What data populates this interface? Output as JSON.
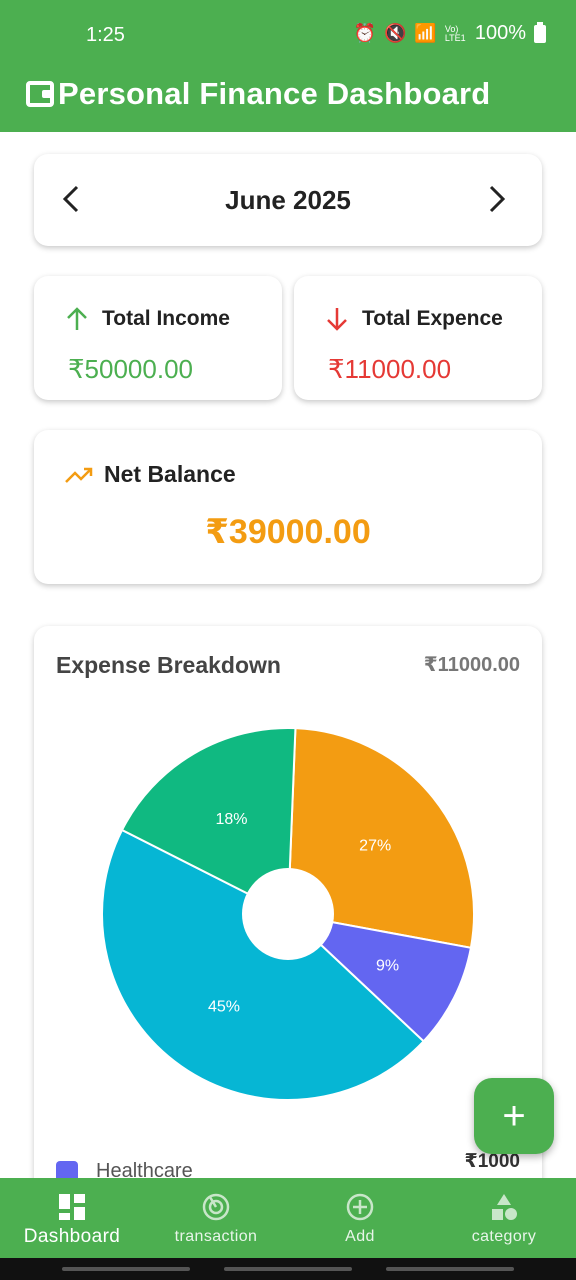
{
  "status_bar": {
    "time": "1:25",
    "battery": "100%",
    "network": "Vo) LTE1"
  },
  "app_bar": {
    "title": "Personal Finance Dashboard"
  },
  "month_selector": {
    "label": "June 2025"
  },
  "income": {
    "label": "Total Income",
    "value": "₹50000.00"
  },
  "expense": {
    "label": "Total Expence",
    "value": "₹11000.00"
  },
  "balance": {
    "label": "Net Balance",
    "value": "₹39000.00"
  },
  "breakdown": {
    "title": "Expense Breakdown",
    "total": "₹11000.00",
    "legend": [
      {
        "label": "Healthcare",
        "amount": "₹1000",
        "color": "#6366f1"
      }
    ]
  },
  "chart_data": {
    "type": "pie",
    "title": "Expense Breakdown",
    "series": [
      {
        "label": "27%",
        "value": 27,
        "color": "#f39c12"
      },
      {
        "label": "9%",
        "value": 9,
        "color": "#6366f1"
      },
      {
        "label": "45%",
        "value": 45,
        "color": "#06b6d4"
      },
      {
        "label": "18%",
        "value": 18,
        "color": "#10b981"
      }
    ],
    "donut_hole": true
  },
  "fab": {
    "symbol": "+"
  },
  "bottom_nav": {
    "items": [
      {
        "label": "Dashboard",
        "icon": "dashboard-icon",
        "active": true
      },
      {
        "label": "transaction",
        "icon": "transaction-icon",
        "active": false
      },
      {
        "label": "Add",
        "icon": "add-circle-icon",
        "active": false
      },
      {
        "label": "category",
        "icon": "category-icon",
        "active": false
      }
    ]
  },
  "colors": {
    "primary": "#4caf50",
    "income": "#4caf50",
    "expense": "#e53935",
    "balance": "#f39c12"
  }
}
